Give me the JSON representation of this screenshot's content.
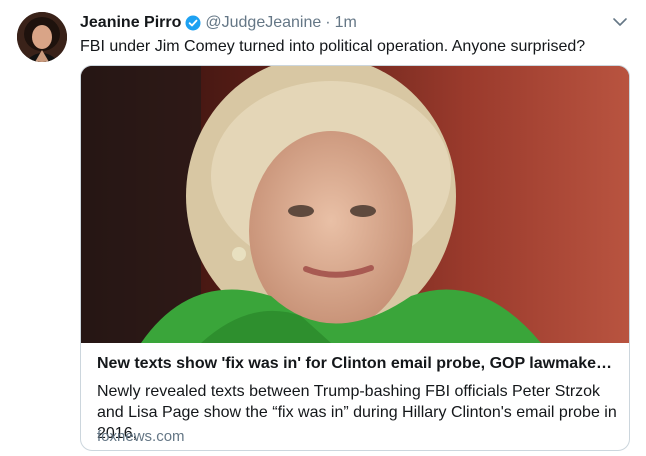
{
  "tweet": {
    "display_name": "Jeanine Pirro",
    "handle": "@JudgeJeanine",
    "separator": "·",
    "time": "1m",
    "text": "FBI under Jim Comey turned into political operation. Anyone surprised?"
  },
  "card": {
    "title": "New texts show 'fix was in' for Clinton email probe, GOP lawmakers s...",
    "description": "Newly revealed texts between Trump-bashing FBI officials Peter Strzok and Lisa Page show the “fix was in” during Hillary Clinton's email probe in 2016,",
    "domain": "foxnews.com"
  },
  "icons": {
    "verified": "verified-badge-icon",
    "menu": "chevron-down-icon"
  },
  "colors": {
    "verified": "#1da1f2",
    "secondary_text": "#657786",
    "card_border": "#ccd6dd"
  }
}
